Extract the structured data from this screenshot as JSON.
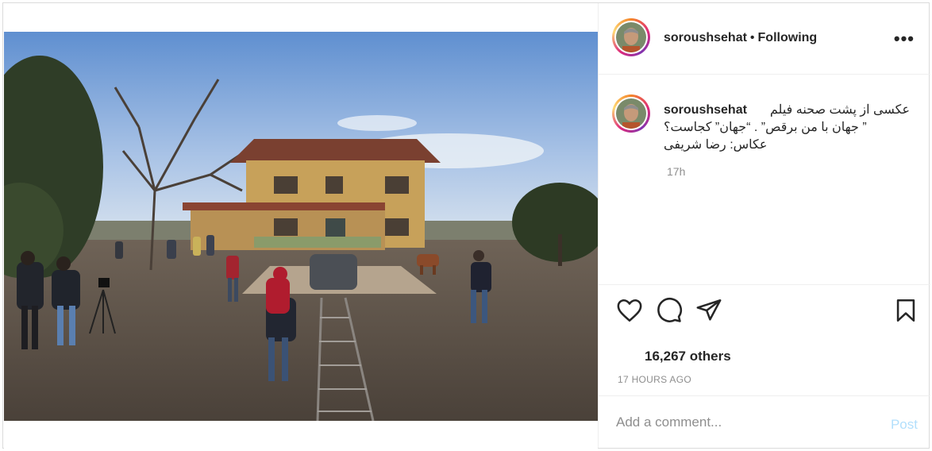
{
  "post": {
    "photo_alt_icon": "photo-behind-the-scenes",
    "colors": {
      "link": "#262626",
      "muted": "#8e8e8e",
      "post_disabled": "#b2dffc",
      "border": "#dbdbdb"
    }
  },
  "header": {
    "username": "soroushsehat",
    "separator": "•",
    "follow_status": "Following",
    "more_icon": "•••"
  },
  "caption": {
    "username": "soroushsehat",
    "line1": "عکسی از پشت صحنه فیلم",
    "line2": "” جهان با من برقص” . “جهان” کجاست؟",
    "line3": "عکاس: رضا شریفی",
    "time": "17h"
  },
  "actions": {
    "icons": [
      "heart-icon",
      "comment-icon",
      "share-icon",
      "bookmark-icon"
    ]
  },
  "likes": {
    "count": "16,267 others"
  },
  "posted_time": "17 HOURS AGO",
  "comment": {
    "placeholder": "Add a comment...",
    "post_label": "Post"
  }
}
